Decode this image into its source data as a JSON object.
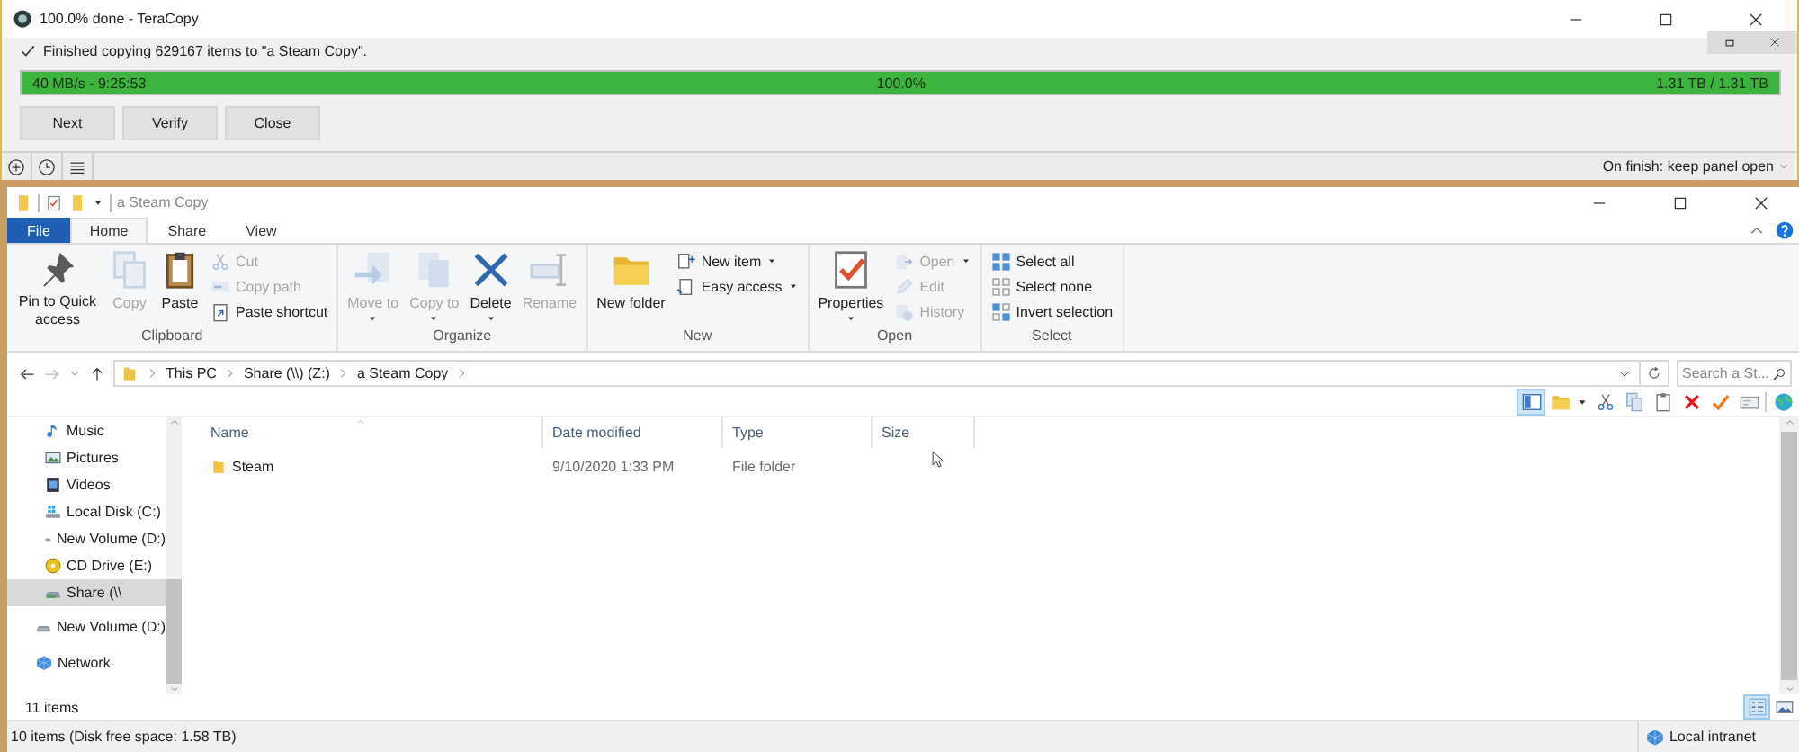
{
  "teracopy": {
    "title": "100.0% done - TeraCopy",
    "message": "Finished copying 629167 items to \"a Steam Copy\".",
    "progress": {
      "level": 1.0,
      "speed": "40 MB/s - 9:25:53",
      "percent": "100.0%",
      "size": "1.31 TB / 1.31 TB"
    },
    "buttons": [
      "Next",
      "Verify",
      "Close"
    ],
    "on_finish": "On finish: keep panel open"
  },
  "explorer": {
    "title": "a Steam Copy",
    "tabs": [
      {
        "label": "File",
        "kind": "menu",
        "selected": false
      },
      {
        "label": "Home",
        "kind": "tab",
        "selected": true
      },
      {
        "label": "Share",
        "kind": "tab",
        "selected": false
      },
      {
        "label": "View",
        "kind": "tab",
        "selected": false
      }
    ],
    "ribbon": [
      {
        "label": "Clipboard",
        "commands": [
          {
            "label": "Pin to Quick access",
            "kind": "large",
            "disabled": false,
            "dropdown": false
          },
          {
            "label": "Copy",
            "kind": "large",
            "disabled": true,
            "dropdown": false
          },
          {
            "label": "Paste",
            "kind": "large",
            "disabled": false,
            "dropdown": false
          },
          {
            "label": "Cut",
            "kind": "small",
            "disabled": true,
            "dropdown": false
          },
          {
            "label": "Copy path",
            "kind": "small",
            "disabled": true,
            "dropdown": false
          },
          {
            "label": "Paste shortcut",
            "kind": "small",
            "disabled": false,
            "dropdown": false
          }
        ]
      },
      {
        "label": "Organize",
        "commands": [
          {
            "label": "Move to",
            "kind": "large",
            "disabled": true,
            "dropdown": true
          },
          {
            "label": "Copy to",
            "kind": "large",
            "disabled": true,
            "dropdown": true
          },
          {
            "label": "Delete",
            "kind": "large",
            "disabled": false,
            "dropdown": true
          },
          {
            "label": "Rename",
            "kind": "large",
            "disabled": true,
            "dropdown": false
          }
        ]
      },
      {
        "label": "New",
        "commands": [
          {
            "label": "New folder",
            "kind": "large",
            "disabled": false,
            "dropdown": false
          },
          {
            "label": "New item",
            "kind": "small",
            "disabled": false,
            "dropdown": true
          },
          {
            "label": "Easy access",
            "kind": "small",
            "disabled": false,
            "dropdown": true
          }
        ]
      },
      {
        "label": "Open",
        "commands": [
          {
            "label": "Properties",
            "kind": "large",
            "disabled": false,
            "dropdown": true
          },
          {
            "label": "Open",
            "kind": "small",
            "disabled": true,
            "dropdown": true
          },
          {
            "label": "Edit",
            "kind": "small",
            "disabled": true,
            "dropdown": false
          },
          {
            "label": "History",
            "kind": "small",
            "disabled": true,
            "dropdown": false
          }
        ]
      },
      {
        "label": "Select",
        "commands": [
          {
            "label": "Select all",
            "kind": "small",
            "disabled": false,
            "dropdown": false
          },
          {
            "label": "Select none",
            "kind": "small",
            "disabled": false,
            "dropdown": false
          },
          {
            "label": "Invert selection",
            "kind": "small",
            "disabled": false,
            "dropdown": false
          }
        ]
      }
    ],
    "address": {
      "crumbs": [
        "This PC",
        "Share (\\\\) (Z:)",
        "a Steam Copy"
      ]
    },
    "search": {
      "placeholder": "Search a St..."
    },
    "toolbar": [
      {
        "selected": true
      },
      {
        "selected": false
      },
      {
        "selected": false
      },
      {
        "selected": false
      },
      {
        "selected": false
      },
      {
        "selected": false
      },
      {
        "selected": false
      },
      {
        "selected": false
      },
      {
        "selected": false
      }
    ],
    "nav_pane": {
      "this_pc": [
        {
          "label": "Music",
          "selected": false
        },
        {
          "label": "Pictures",
          "selected": false
        },
        {
          "label": "Videos",
          "selected": false
        },
        {
          "label": "Local Disk (C:)",
          "selected": false
        },
        {
          "label": "New Volume (D:)",
          "selected": false
        },
        {
          "label": "CD Drive (E:)",
          "selected": false
        },
        {
          "label": "Share (\\\\",
          "selected": true
        }
      ],
      "items": [
        {
          "label": "New Volume (D:)",
          "selected": false
        },
        {
          "label": "Network",
          "selected": false
        }
      ]
    },
    "file_list": {
      "columns": [
        "Name",
        "Date modified",
        "Type",
        "Size"
      ],
      "rows": [
        {
          "name": "Steam",
          "date_modified": "9/10/2020 1:33 PM",
          "type": "File folder",
          "selected": false
        }
      ]
    },
    "item_count": "11 items",
    "views": [
      {
        "selected": true
      },
      {
        "selected": false
      }
    ],
    "status_bar": {
      "text": "10 items (Disk free space: 1.58 TB)",
      "zone": "Local intranet"
    }
  }
}
